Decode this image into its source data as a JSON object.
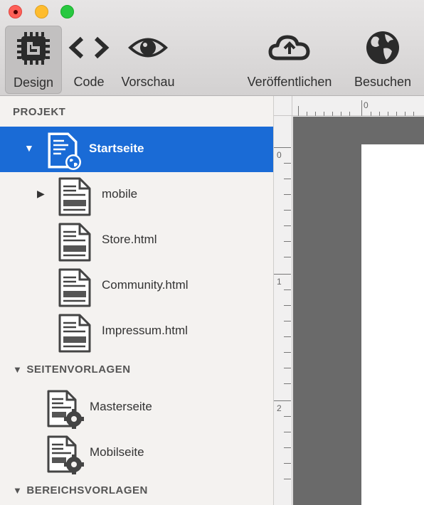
{
  "window": {
    "traffic_lights": [
      "close",
      "minimize",
      "maximize"
    ],
    "colors": {
      "close": "#fe5f57",
      "minimize": "#febc2e",
      "maximize": "#28c840"
    }
  },
  "toolbar": {
    "design": "Design",
    "code": "Code",
    "preview": "Vorschau",
    "publish": "Veröffentlichen",
    "visit": "Besuchen",
    "active": "Design"
  },
  "sidebar": {
    "sections": {
      "project": "PROJEKT",
      "page_templates": "SEITENVORLAGEN",
      "area_templates": "BEREICHSVORLAGEN"
    },
    "pages": [
      {
        "label": "Startseite",
        "icon": "home-page-icon",
        "selected": true,
        "expanded": true
      },
      {
        "label": "mobile",
        "icon": "page-icon",
        "selected": false,
        "expanded": false
      },
      {
        "label": "Store.html",
        "icon": "page-icon",
        "selected": false
      },
      {
        "label": "Community.html",
        "icon": "page-icon",
        "selected": false
      },
      {
        "label": "Impressum.html",
        "icon": "page-icon",
        "selected": false
      }
    ],
    "templates": [
      {
        "label": "Masterseite",
        "icon": "template-gear-icon"
      },
      {
        "label": "Mobilseite",
        "icon": "template-gear-icon"
      }
    ],
    "selection_color": "#1a6bd6"
  },
  "ruler": {
    "h_labels": [
      "0"
    ],
    "v_labels": [
      "0",
      "1",
      "2"
    ]
  }
}
